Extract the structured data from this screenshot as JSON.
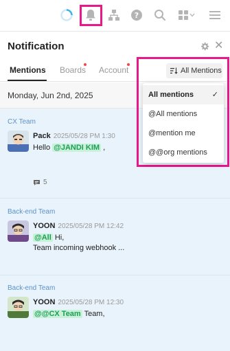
{
  "colors": {
    "highlight": "#e8178a",
    "mention_bg": "#c7f2d8",
    "mention_text": "#1f9c58",
    "team_label": "#5a93c9",
    "feed_bg": "#e9f3fb",
    "badge_dot": "#ef4a4a"
  },
  "toolbar": {
    "icons": [
      "loading-ring-icon",
      "bell-icon",
      "org-chart-icon",
      "help-icon",
      "search-icon",
      "apps-grid-icon",
      "chevron-down-icon",
      "hamburger-menu-icon"
    ]
  },
  "header": {
    "title": "Notification",
    "icons": [
      "gear-icon",
      "close-icon"
    ],
    "close_symbol": "✕"
  },
  "tabs": [
    {
      "label": "Mentions",
      "active": true,
      "has_dot": false
    },
    {
      "label": "Boards",
      "active": false,
      "has_dot": true
    },
    {
      "label": "Account",
      "active": false,
      "has_dot": true
    }
  ],
  "filter": {
    "label": "All Mentions"
  },
  "date_label": "Monday, Jun 2nd, 2025",
  "notifications": [
    {
      "team": "CX Team",
      "author": "Pack",
      "time": "2025/05/28 PM 1:30",
      "prefix": "Hello ",
      "mention": "@JANDI KIM",
      "suffix": " ,",
      "line2": "",
      "comment_count": "5"
    },
    {
      "team": "Back-end Team",
      "author": "YOON",
      "time": "2025/05/28 PM 12:42",
      "prefix": "",
      "mention": "@All",
      "suffix": " Hi,",
      "line2": "Team incoming webhook ...",
      "comment_count": ""
    },
    {
      "team": "Back-end Team",
      "author": "YOON",
      "time": "2025/05/28 PM 12:30",
      "prefix": "",
      "mention": "@@CX Team",
      "suffix": " Team,",
      "line2": "",
      "comment_count": ""
    }
  ],
  "dropdown": {
    "options": [
      {
        "label": "All mentions",
        "selected": true
      },
      {
        "label": "@All mentions",
        "selected": false
      },
      {
        "label": "@mention me",
        "selected": false
      },
      {
        "label": "@@org mentions",
        "selected": false
      }
    ],
    "check_symbol": "✓"
  }
}
